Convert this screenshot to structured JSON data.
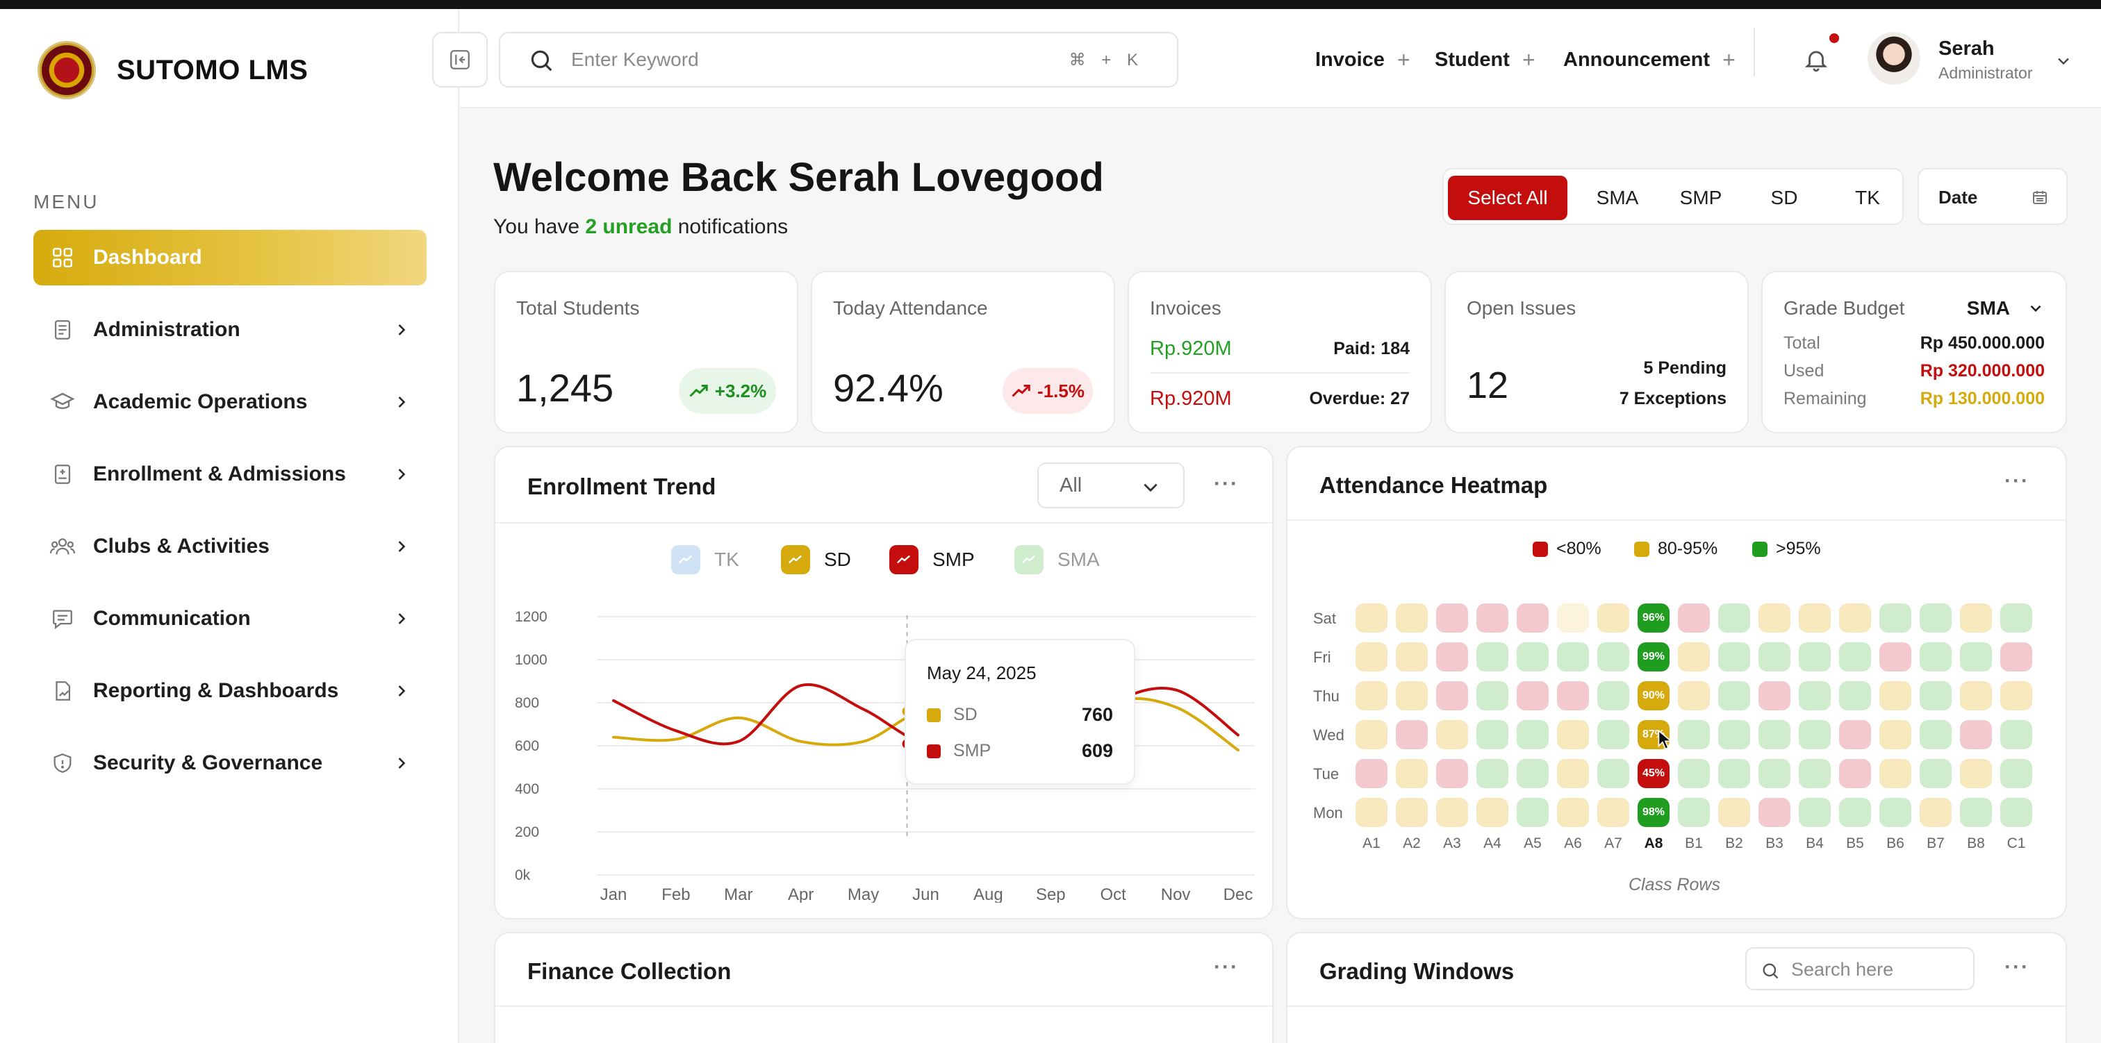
{
  "app": {
    "brand": "SUTOMO LMS"
  },
  "sidebar": {
    "menu_label": "MENU",
    "items": [
      {
        "label": "Dashboard",
        "icon": "grid-icon",
        "active": true
      },
      {
        "label": "Administration",
        "icon": "document-icon"
      },
      {
        "label": "Academic Operations",
        "icon": "graduation-cap-icon"
      },
      {
        "label": "Enrollment & Admissions",
        "icon": "clipboard-icon"
      },
      {
        "label": "Clubs & Activities",
        "icon": "users-group-icon"
      },
      {
        "label": "Communication",
        "icon": "chat-icon"
      },
      {
        "label": "Reporting & Dashboards",
        "icon": "report-icon"
      },
      {
        "label": "Security & Governance",
        "icon": "shield-icon"
      }
    ]
  },
  "header": {
    "search_placeholder": "Enter Keyword",
    "shortcut": "⌘ + K",
    "quick_actions": [
      "Invoice",
      "Student",
      "Announcement"
    ],
    "user": {
      "name": "Serah",
      "role": "Administrator"
    }
  },
  "welcome": {
    "title": "Welcome Back Serah Lovegood",
    "notif_prefix": "You have ",
    "notif_highlight": "2 unread",
    "notif_suffix": " notifications"
  },
  "filters": {
    "options": [
      "Select All",
      "SMA",
      "SMP",
      "SD",
      "TK"
    ],
    "selected": "Select All",
    "date_label": "Date"
  },
  "kpis": {
    "total_students": {
      "label": "Total Students",
      "value": "1,245",
      "change": "+3.2%"
    },
    "attendance": {
      "label": "Today Attendance",
      "value": "92.4%",
      "change": "-1.5%"
    },
    "invoices": {
      "label": "Invoices",
      "paid_amount": "Rp.920M",
      "paid_label": "Paid: 184",
      "overdue_amount": "Rp.920M",
      "overdue_label": "Overdue: 27"
    },
    "issues": {
      "label": "Open Issues",
      "value": "12",
      "pending": "5 Pending",
      "exceptions": "7 Exceptions"
    },
    "budget": {
      "label": "Grade Budget",
      "selected": "SMA",
      "total_label": "Total",
      "total": "Rp 450.000.000",
      "used_label": "Used",
      "used": "Rp 320.000.000",
      "remaining_label": "Remaining",
      "remaining": "Rp 130.000.000"
    }
  },
  "enrollment": {
    "title": "Enrollment Trend",
    "filter": "All",
    "tooltip": {
      "date": "May 24, 2025",
      "rows": [
        {
          "name": "SD",
          "value": "760"
        },
        {
          "name": "SMP",
          "value": "609"
        }
      ]
    }
  },
  "chart_data": {
    "type": "line",
    "title": "Enrollment Trend",
    "categories": [
      "Jan",
      "Feb",
      "Mar",
      "Apr",
      "May",
      "Jun",
      "Aug",
      "Sep",
      "Oct",
      "Nov",
      "Dec"
    ],
    "ylim": [
      0,
      1200
    ],
    "yticks": [
      "0k",
      "200",
      "400",
      "600",
      "800",
      "1000",
      "1200"
    ],
    "legend": [
      "TK",
      "SD",
      "SMP",
      "SMA"
    ],
    "hidden_series": [
      "TK",
      "SMA"
    ],
    "series": [
      {
        "name": "SD",
        "color": "#d6aa0c",
        "values": [
          640,
          630,
          730,
          620,
          620,
          760,
          650,
          560,
          800,
          780,
          580
        ]
      },
      {
        "name": "SMP",
        "color": "#c40d0d",
        "values": [
          810,
          670,
          620,
          880,
          770,
          610,
          650,
          580,
          800,
          860,
          650
        ]
      }
    ],
    "colors": {
      "TK": "#8ab8e0",
      "SD": "#d6aa0c",
      "SMP": "#c40d0d",
      "SMA": "#93d08f"
    }
  },
  "heatmap": {
    "title": "Attendance Heatmap",
    "legend": [
      {
        "label": "<80%",
        "color": "#c40d0d"
      },
      {
        "label": "80-95%",
        "color": "#d6aa0c"
      },
      {
        "label": ">95%",
        "color": "#1f9d1f"
      }
    ],
    "rows": [
      "Sat",
      "Fri",
      "Thu",
      "Wed",
      "Tue",
      "Mon"
    ],
    "cols": [
      "A1",
      "A2",
      "A3",
      "A4",
      "A5",
      "A6",
      "A7",
      "A8",
      "B1",
      "B2",
      "B3",
      "B4",
      "B5",
      "B6",
      "B7",
      "B8",
      "C1"
    ],
    "highlight_col": "A8",
    "highlight_values": [
      "96%",
      "99%",
      "90%",
      "87%",
      "45%",
      "98%"
    ],
    "axis_label": "Class Rows",
    "levels": [
      [
        "y",
        "y",
        "r",
        "r",
        "r",
        "p",
        "y",
        "G",
        "r",
        "g",
        "y",
        "y",
        "y",
        "g",
        "g",
        "y",
        "g"
      ],
      [
        "y",
        "y",
        "r",
        "g",
        "g",
        "g",
        "g",
        "G",
        "y",
        "g",
        "g",
        "g",
        "g",
        "r",
        "g",
        "g",
        "r"
      ],
      [
        "y",
        "y",
        "r",
        "g",
        "r",
        "r",
        "g",
        "Y",
        "y",
        "g",
        "r",
        "g",
        "g",
        "y",
        "g",
        "y",
        "y"
      ],
      [
        "y",
        "r",
        "y",
        "g",
        "g",
        "y",
        "g",
        "Y",
        "g",
        "g",
        "g",
        "g",
        "r",
        "y",
        "g",
        "r",
        "g"
      ],
      [
        "r",
        "y",
        "r",
        "g",
        "g",
        "y",
        "g",
        "R",
        "g",
        "g",
        "g",
        "g",
        "r",
        "y",
        "g",
        "y",
        "g"
      ],
      [
        "y",
        "y",
        "y",
        "y",
        "g",
        "y",
        "y",
        "G",
        "g",
        "y",
        "r",
        "g",
        "g",
        "g",
        "y",
        "g",
        "g"
      ]
    ]
  },
  "finance": {
    "title": "Finance Collection"
  },
  "grading": {
    "title": "Grading Windows",
    "search_placeholder": "Search here"
  }
}
